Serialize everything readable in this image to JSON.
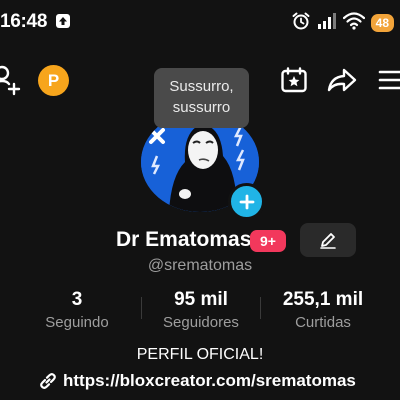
{
  "status_bar": {
    "time": "16:48",
    "battery": "48"
  },
  "toolbar": {
    "points_badge": "P"
  },
  "tooltip": {
    "text": "Sussurro, sussurro"
  },
  "profile": {
    "display_name": "Dr Ematomas",
    "notification_badge": "9+",
    "username": "@srematomas",
    "bio": "PERFIL OFICIAL!",
    "link": "https://bloxcreator.com/srematomas"
  },
  "stats": [
    {
      "value": "3",
      "label": "Seguindo"
    },
    {
      "value": "95 mil",
      "label": "Seguidores"
    },
    {
      "value": "255,1 mil",
      "label": "Curtidas"
    }
  ],
  "colors": {
    "background": "#121212",
    "points_badge": "#f7a51c",
    "notification_badge": "#f2385c",
    "add_avatar": "#20b4e6",
    "avatar_bg": "#1761d8"
  }
}
